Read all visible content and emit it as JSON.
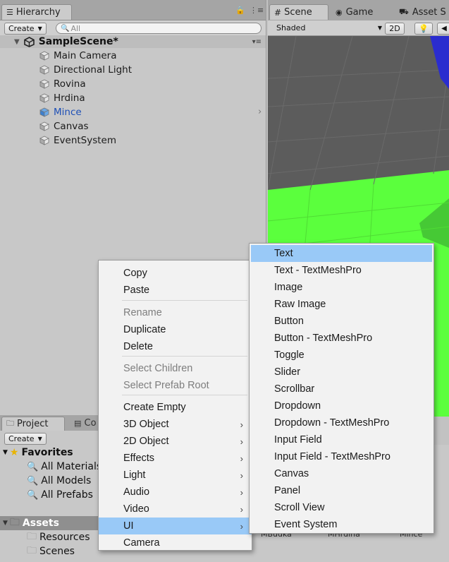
{
  "hierarchy": {
    "tab_label": "Hierarchy",
    "create_label": "Create",
    "search_placeholder": "All",
    "scene_name": "SampleScene*",
    "objects": [
      {
        "label": "Main Camera",
        "selected": false
      },
      {
        "label": "Directional Light",
        "selected": false
      },
      {
        "label": "Rovina",
        "selected": false
      },
      {
        "label": "Hrdina",
        "selected": false
      },
      {
        "label": "Mince",
        "selected": true
      },
      {
        "label": "Canvas",
        "selected": false
      },
      {
        "label": "EventSystem",
        "selected": false
      }
    ]
  },
  "scene_view": {
    "tabs": [
      "Scene",
      "Game",
      "Asset S"
    ],
    "shading_mode": "Shaded",
    "mode_2d": "2D"
  },
  "project": {
    "tabs": [
      "Project",
      "Co"
    ],
    "create_label": "Create",
    "favorites_label": "Favorites",
    "favorites": [
      "All Materials",
      "All Models",
      "All Prefabs"
    ],
    "assets_label": "Assets",
    "asset_folders": [
      "Resources",
      "Scenes"
    ],
    "grid_labels": [
      "MBudka",
      "MHrdina",
      "Mince"
    ]
  },
  "context_menu": {
    "items": [
      {
        "label": "Copy",
        "disabled": false
      },
      {
        "label": "Paste",
        "disabled": false
      },
      {
        "label": "Rename",
        "disabled": true
      },
      {
        "label": "Duplicate",
        "disabled": false
      },
      {
        "label": "Delete",
        "disabled": false
      },
      {
        "label": "Select Children",
        "disabled": true
      },
      {
        "label": "Select Prefab Root",
        "disabled": true
      },
      {
        "label": "Create Empty",
        "disabled": false
      },
      {
        "label": "3D Object",
        "submenu": true
      },
      {
        "label": "2D Object",
        "submenu": true
      },
      {
        "label": "Effects",
        "submenu": true
      },
      {
        "label": "Light",
        "submenu": true
      },
      {
        "label": "Audio",
        "submenu": true
      },
      {
        "label": "Video",
        "submenu": true
      },
      {
        "label": "UI",
        "submenu": true,
        "highlighted": true
      },
      {
        "label": "Camera",
        "disabled": false
      }
    ]
  },
  "ui_submenu": {
    "items": [
      "Text",
      "Text - TextMeshPro",
      "Image",
      "Raw Image",
      "Button",
      "Button - TextMeshPro",
      "Toggle",
      "Slider",
      "Scrollbar",
      "Dropdown",
      "Dropdown - TextMeshPro",
      "Input Field",
      "Input Field - TextMeshPro",
      "Canvas",
      "Panel",
      "Scroll View",
      "Event System"
    ],
    "highlighted": "Text"
  },
  "colors": {
    "highlight": "#99c9f7",
    "selected_text": "#1d4fb6",
    "ground": "#5bff3d"
  }
}
